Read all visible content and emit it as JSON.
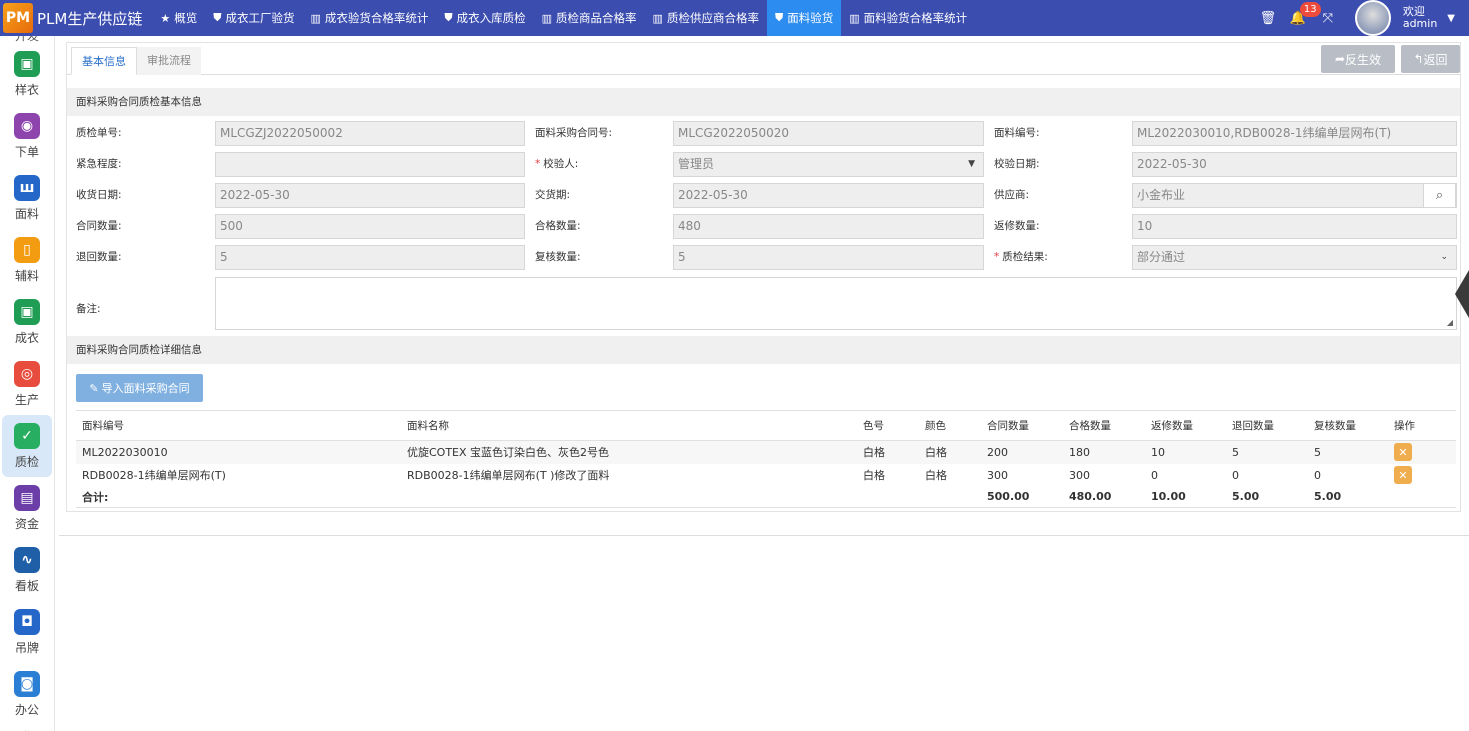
{
  "app": {
    "logo": "PM",
    "title": "PLM生产供应链"
  },
  "nav_tabs": [
    {
      "icon": "star-icon",
      "glyph": "★",
      "label": "概览"
    },
    {
      "icon": "shield-icon",
      "glyph": "⛊",
      "label": "成衣工厂验货"
    },
    {
      "icon": "bar-chart-icon",
      "glyph": "▥",
      "label": "成衣验货合格率统计"
    },
    {
      "icon": "shield-icon",
      "glyph": "⛊",
      "label": "成衣入库质检"
    },
    {
      "icon": "bar-chart-icon",
      "glyph": "▥",
      "label": "质检商品合格率"
    },
    {
      "icon": "bar-chart-icon",
      "glyph": "▥",
      "label": "质检供应商合格率"
    },
    {
      "icon": "shield-icon",
      "glyph": "⛊",
      "label": "面料验货"
    },
    {
      "icon": "bar-chart-icon",
      "glyph": "▥",
      "label": "面料验货合格率统计"
    }
  ],
  "active_nav_index": 6,
  "topright": {
    "notification_count": "13",
    "welcome": "欢迎",
    "username": "admin"
  },
  "sidebar": {
    "partial_top_label": "开发",
    "items": [
      {
        "label": "样衣",
        "icon": "shirt-icon",
        "color": "#1f9d55",
        "glyph": "▣"
      },
      {
        "label": "下单",
        "icon": "order-icon",
        "color": "#8e44ad",
        "glyph": "◉"
      },
      {
        "label": "面料",
        "icon": "fabric-icon",
        "color": "#2467c9",
        "glyph": "ш"
      },
      {
        "label": "辅料",
        "icon": "accessory-icon",
        "color": "#f39c12",
        "glyph": "▯"
      },
      {
        "label": "成衣",
        "icon": "garment-icon",
        "color": "#1f9d55",
        "glyph": "▣"
      },
      {
        "label": "生产",
        "icon": "production-icon",
        "color": "#e74c3c",
        "glyph": "◎"
      },
      {
        "label": "质检",
        "icon": "quality-check-icon",
        "color": "#27ae60",
        "glyph": "✓"
      },
      {
        "label": "资金",
        "icon": "finance-icon",
        "color": "#6c3fa8",
        "glyph": "▤"
      },
      {
        "label": "看板",
        "icon": "dashboard-icon",
        "color": "#1f5fa8",
        "glyph": "∿"
      },
      {
        "label": "吊牌",
        "icon": "tag-icon",
        "color": "#2467c9",
        "glyph": "◘"
      },
      {
        "label": "办公",
        "icon": "office-icon",
        "color": "#2a7ed3",
        "glyph": "◙"
      }
    ],
    "active_index": 6
  },
  "page_tabs": [
    "基本信息",
    "审批流程"
  ],
  "actions": {
    "unapprove": "反生效",
    "back": "返回"
  },
  "basic": {
    "section_title": "面料采购合同质检基本信息",
    "qc_no_label": "质检单号:",
    "qc_no": "MLCGZJ2022050002",
    "contract_no_label": "面料采购合同号:",
    "contract_no": "MLCG2022050020",
    "fabric_code_label": "面料编号:",
    "fabric_code": "ML2022030010,RDB0028-1纬编单层网布(T)",
    "urgency_label": "紧急程度:",
    "urgency": "",
    "inspector_label": "校验人:",
    "inspector": "管理员",
    "inspect_date_label": "校验日期:",
    "inspect_date": "2022-05-30",
    "receive_date_label": "收货日期:",
    "receive_date": "2022-05-30",
    "delivery_label": "交货期:",
    "delivery": "2022-05-30",
    "supplier_label": "供应商:",
    "supplier": "小金布业",
    "contract_qty_label": "合同数量:",
    "contract_qty": "500",
    "pass_qty_label": "合格数量:",
    "pass_qty": "480",
    "repair_qty_label": "返修数量:",
    "repair_qty": "10",
    "return_qty_label": "退回数量:",
    "return_qty": "5",
    "recheck_qty_label": "复核数量:",
    "recheck_qty": "5",
    "result_label": "质检结果:",
    "result": "部分通过",
    "remark_label": "备注:",
    "remark": ""
  },
  "detail": {
    "section_title": "面料采购合同质检详细信息",
    "import_button": "导入面料采购合同",
    "columns": [
      "面料编号",
      "面料名称",
      "色号",
      "颜色",
      "合同数量",
      "合格数量",
      "返修数量",
      "退回数量",
      "复核数量",
      "操作"
    ],
    "rows": [
      [
        "ML2022030010",
        "优旋COTEX 宝蓝色订染白色、灰色2号色",
        "白格",
        "白格",
        "200",
        "180",
        "10",
        "5",
        "5"
      ],
      [
        "RDB0028-1纬编单层网布(T)",
        "RDB0028-1纬编单层网布(T )修改了面料",
        "白格",
        "白格",
        "300",
        "300",
        "0",
        "0",
        "0"
      ]
    ],
    "total": {
      "label": "合计:",
      "contract": "500.00",
      "pass": "480.00",
      "repair": "10.00",
      "return": "5.00",
      "recheck": "5.00"
    }
  }
}
